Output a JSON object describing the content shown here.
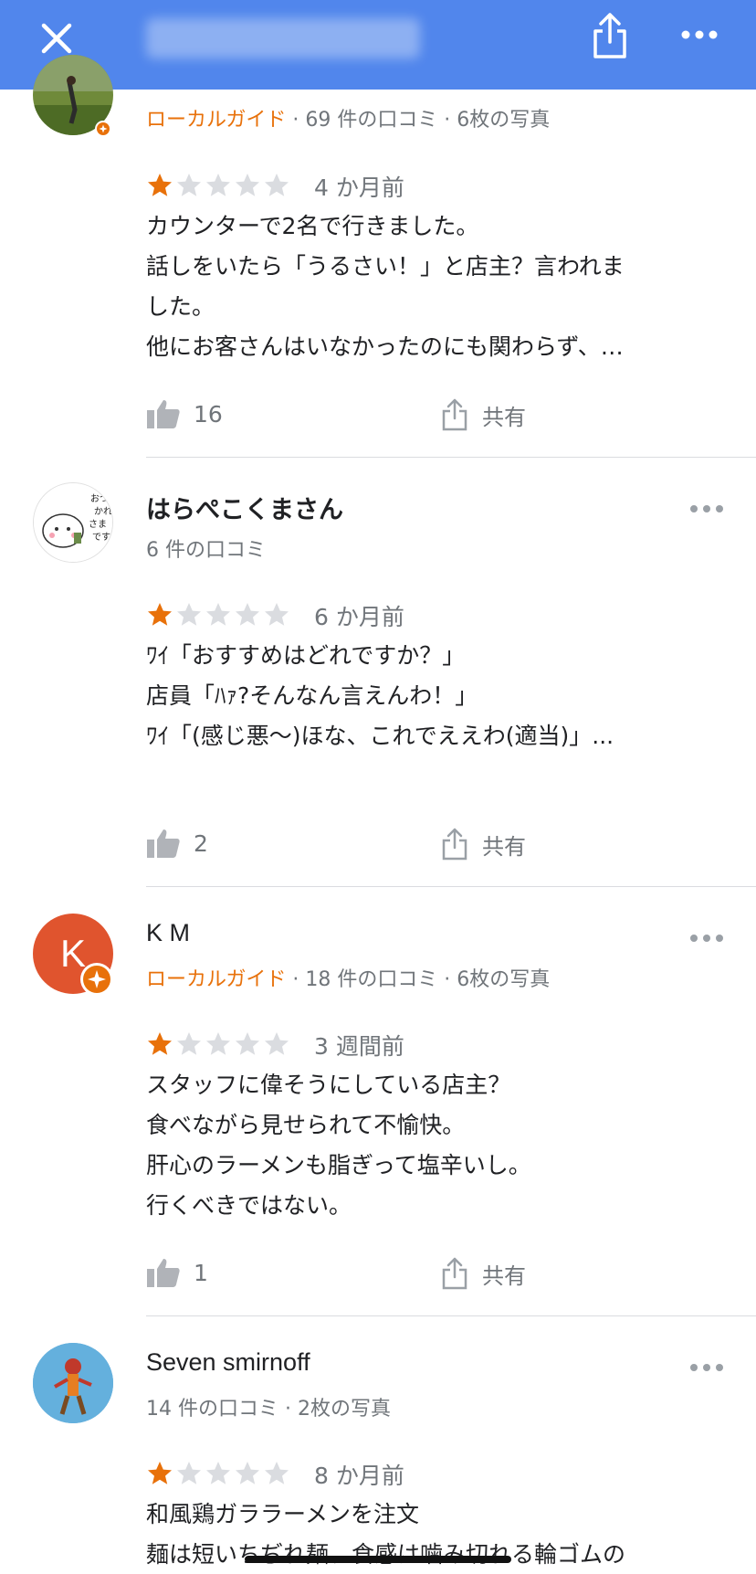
{
  "header": {
    "close_icon": "close-icon",
    "share_icon": "share-icon",
    "more_icon": "more-icon"
  },
  "colors": {
    "topbar": "#5186ec",
    "star_filled": "#e8710a",
    "star_empty": "#dadce0",
    "guide": "#e8710a",
    "avatar_km": "#e0542e"
  },
  "reviews": [
    {
      "name": "",
      "guide": "ローカルガイド",
      "meta": "· 69 件の口コミ · 6枚の写真",
      "rating": 1,
      "time": "4 か月前",
      "lines": [
        "カウンターで2名で行きました。",
        "話しをいたら「うるさい！」と店主？言われま",
        "した。",
        "他にお客さんはいなかったのにも関わらず、…"
      ],
      "likes": "16",
      "share": "共有"
    },
    {
      "name": "はらぺこくまさん",
      "meta": "6 件の口コミ",
      "avatar_text": "おつかれさまです",
      "rating": 1,
      "time": "6 か月前",
      "lines": [
        "ﾜｲ「おすすめはどれですか？」",
        "店員「ﾊｧ?そんなん言えんわ！」",
        "ﾜｲ「(感じ悪〜)ほな、これでええわ(適当)」..."
      ],
      "likes": "2",
      "share": "共有"
    },
    {
      "name": "K M",
      "avatar_letter": "K",
      "guide": "ローカルガイド",
      "meta": "· 18 件の口コミ · 6枚の写真",
      "rating": 1,
      "time": "3 週間前",
      "lines": [
        "スタッフに偉そうにしている店主？",
        "食べながら見せられて不愉快。",
        "肝心のラーメンも脂ぎって塩辛いし。",
        "行くべきではない。"
      ],
      "likes": "1",
      "share": "共有"
    },
    {
      "name": "Seven smirnoff",
      "meta": "14 件の口コミ · 2枚の写真",
      "rating": 1,
      "time": "8 か月前",
      "lines": [
        "和風鶏ガララーメンを注文",
        "麺は短いちぢれ麺、食感は噛み切れる輪ゴムの"
      ]
    }
  ]
}
